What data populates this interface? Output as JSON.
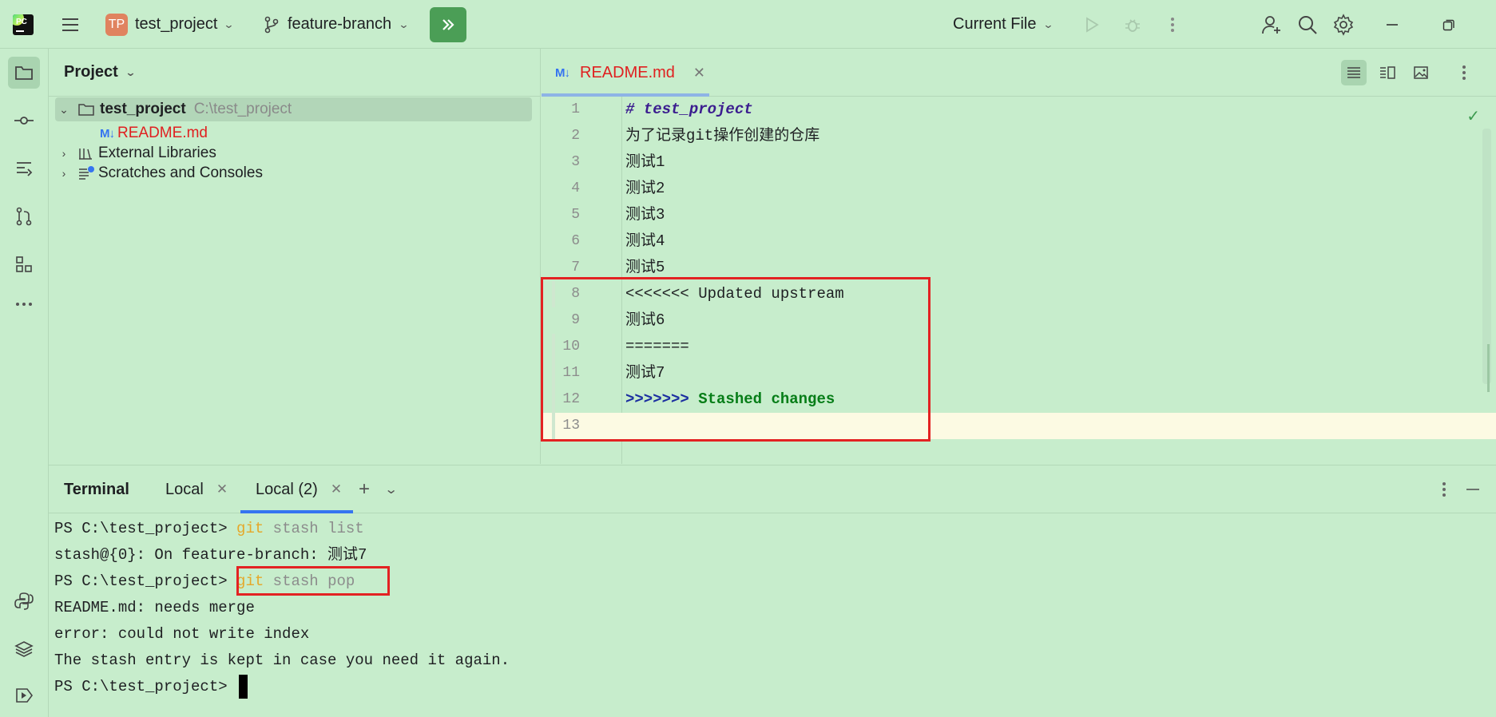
{
  "titlebar": {
    "logo_text": "PC",
    "project_badge": "TP",
    "project_name": "test_project",
    "branch_name": "feature-branch",
    "run_config": "Current File"
  },
  "project_panel": {
    "title": "Project",
    "root_name": "test_project",
    "root_path": "C:\\test_project",
    "readme_icon": "M↓",
    "readme_file": "README.md",
    "external_libraries": "External Libraries",
    "scratches": "Scratches and Consoles"
  },
  "editor": {
    "tab_icon": "M↓",
    "tab_label": "README.md",
    "lines": [
      {
        "n": "1",
        "text": "# test_project"
      },
      {
        "n": "2",
        "text": "为了记录git操作创建的仓库"
      },
      {
        "n": "3",
        "text": "测试1"
      },
      {
        "n": "4",
        "text": "测试2"
      },
      {
        "n": "5",
        "text": "测试3"
      },
      {
        "n": "6",
        "text": "测试4"
      },
      {
        "n": "7",
        "text": "测试5"
      },
      {
        "n": "8",
        "text": "<<<<<<< Updated upstream"
      },
      {
        "n": "9",
        "text": "测试6"
      },
      {
        "n": "10",
        "text": "======="
      },
      {
        "n": "11",
        "text": "测试7"
      },
      {
        "n": "12",
        "arrow": ">>>>>>>",
        "text": " Stashed changes"
      },
      {
        "n": "13",
        "text": ""
      }
    ]
  },
  "terminal": {
    "title": "Terminal",
    "tabs": [
      "Local",
      "Local (2)"
    ],
    "prompt": "PS C:\\test_project> ",
    "cmd1_git": "git",
    "cmd1_rest": " stash list",
    "out1": "stash@{0}: On feature-branch: 测试7",
    "cmd2_git": "git",
    "cmd2_rest": " stash pop",
    "out2": "README.md: needs merge",
    "out3": "error: could not write index",
    "out4": "The stash entry is kept in case you need it again."
  },
  "colors": {
    "background": "#c7edcc",
    "highlight_red": "#e32222",
    "run_button": "#4b9e56",
    "tab_underline": "#3574f0"
  }
}
